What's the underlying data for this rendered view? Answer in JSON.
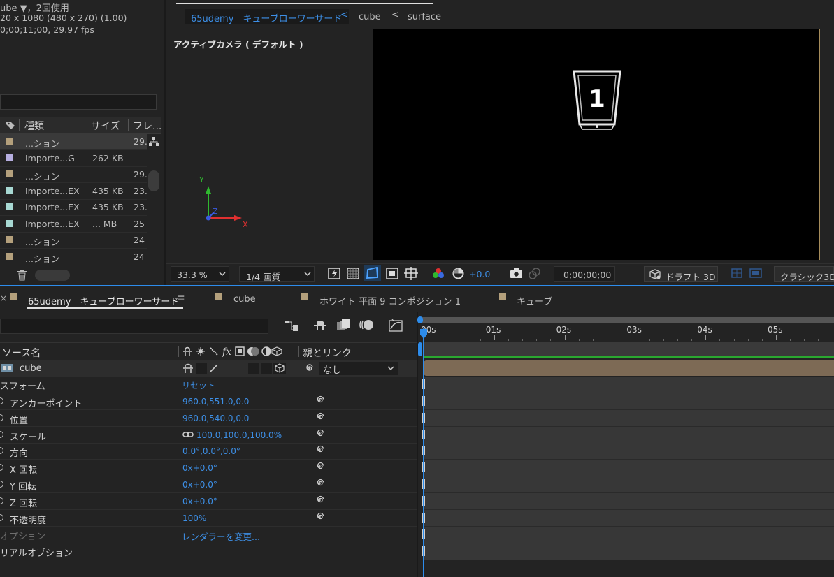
{
  "project": {
    "info_line1": "ube ▼，2回使用",
    "info_line2": "20 x 1080  (480 x 270) (1.00)",
    "info_line3": "0;00;11;00, 29.97 fps",
    "col_type": "種類",
    "col_size": "サイズ",
    "col_frame": "フレ...",
    "items": [
      {
        "name": "...ション",
        "size": "",
        "frame": "29.",
        "color": "#b4a07c"
      },
      {
        "name": "Importe...G",
        "size": "262 KB",
        "frame": "",
        "color": "#b6aee0"
      },
      {
        "name": "...ション",
        "size": "",
        "frame": "29.",
        "color": "#b4a07c"
      },
      {
        "name": "Importe...EX",
        "size": "435 KB",
        "frame": "23.",
        "color": "#a7d8d2"
      },
      {
        "name": "Importe...EX",
        "size": "435 KB",
        "frame": "23.",
        "color": "#a7d8d2"
      },
      {
        "name": "Importe...EX",
        "size": "... MB",
        "frame": "25",
        "color": "#a7d8d2"
      },
      {
        "name": "...ション",
        "size": "",
        "frame": "24",
        "color": "#b4a07c"
      },
      {
        "name": "...ション",
        "size": "",
        "frame": "24",
        "color": "#b4a07c"
      }
    ]
  },
  "viewer": {
    "breadcrumb": [
      "65udemy　キューブローワーサード",
      "cube",
      "surface"
    ],
    "camera_label": "アクティブカメラ ( デフォルト )",
    "comp_number": "1",
    "axis_x": "X",
    "axis_y": "Y",
    "axis_z": "Z",
    "zoom": "33.3 %",
    "resolution": "1/4 画質",
    "exposure": "+0.0",
    "timecode": "0;00;00;00",
    "renderer": "ドラフト 3D",
    "renderer2": "クラシック3D"
  },
  "timeline": {
    "tabs": [
      "65udemy　キューブローワーサード",
      "cube",
      "ホワイト 平面 9 コンポジション 1",
      "キューブ"
    ],
    "tab_menu_icon": "≡",
    "col_source": "ソース名",
    "col_switches": "⚘ ✲ ╲ fx",
    "col_parent": "親とリンク",
    "layer_name": "cube",
    "parent_value": "なし",
    "transform_label": "スフォーム",
    "reset_label": "リセット",
    "properties": [
      {
        "name": "アンカーポイント",
        "value": "960.0,551.0,0.0"
      },
      {
        "name": "位置",
        "value": "960.0,540.0,0.0"
      },
      {
        "name": "スケール",
        "value": "100.0,100.0,100.0%"
      },
      {
        "name": "方向",
        "value": "0.0°,0.0°,0.0°"
      },
      {
        "name": "X 回転",
        "value": "0x+0.0°"
      },
      {
        "name": "Y 回転",
        "value": "0x+0.0°"
      },
      {
        "name": "Z 回転",
        "value": "0x+0.0°"
      },
      {
        "name": "不透明度",
        "value": "100%"
      }
    ],
    "options_label": "オプション",
    "options_value": "レンダラーを変更...",
    "material_label": "リアルオプション",
    "ruler": [
      "00s",
      "01s",
      "02s",
      "03s",
      "04s",
      "05s"
    ]
  },
  "colors": {
    "accent": "#2d8ceb",
    "layer_bar": "#7d6a55",
    "work_area": "#2aa830"
  }
}
